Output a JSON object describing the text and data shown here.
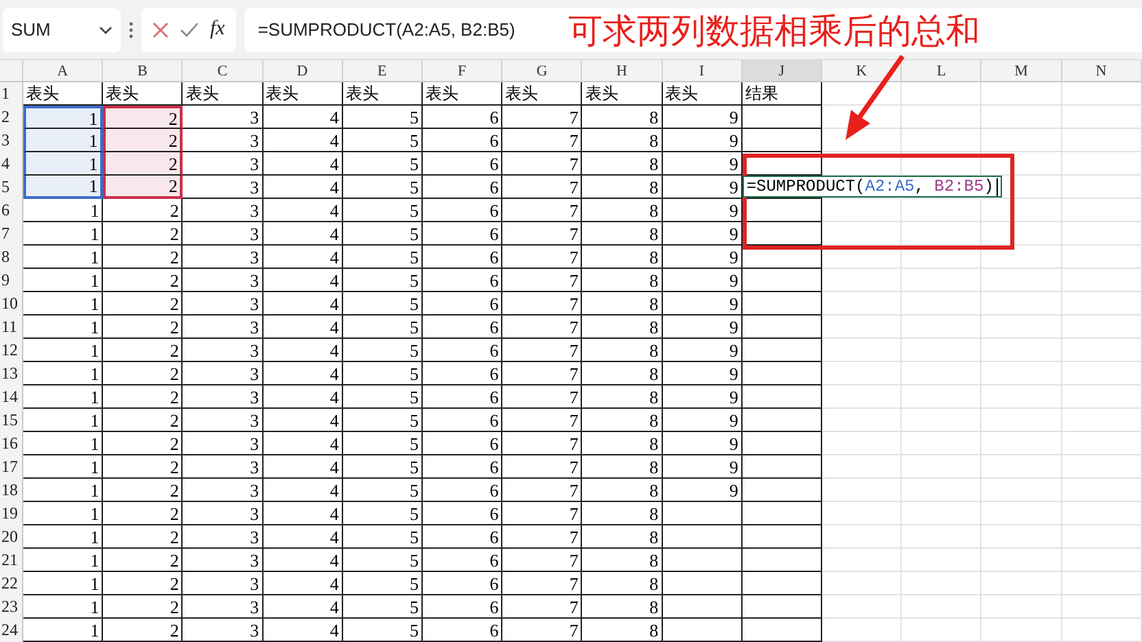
{
  "formula_bar": {
    "name_box": "SUM",
    "fx_label": "fx",
    "formula": "=SUMPRODUCT(A2:A5, B2:B5)"
  },
  "annotation": {
    "text": "可求两列数据相乘后的总和"
  },
  "columns": [
    "A",
    "B",
    "C",
    "D",
    "E",
    "F",
    "G",
    "H",
    "I",
    "J",
    "K",
    "L",
    "M",
    "N"
  ],
  "rows": [
    {
      "header": "1",
      "cells": [
        "表头",
        "表头",
        "表头",
        "表头",
        "表头",
        "表头",
        "表头",
        "表头",
        "表头",
        "结果"
      ]
    },
    {
      "header": "2",
      "cells": [
        "1",
        "2",
        "3",
        "4",
        "5",
        "6",
        "7",
        "8",
        "9"
      ],
      "range_colors": [
        {
          "color": "#3b6fc4"
        },
        {
          "color": "#c8304a"
        }
      ]
    },
    {
      "header": "3",
      "cells": [
        "1",
        "2",
        "3",
        "4",
        "5",
        "6",
        "7",
        "8",
        "9"
      ],
      "range_colors": [
        {
          "color": "#3b6fc4"
        },
        {
          "color": "#c8304a"
        }
      ]
    },
    {
      "header": "4",
      "cells": [
        "1",
        "2",
        "3",
        "4",
        "5",
        "6",
        "7",
        "8",
        "9"
      ],
      "range_colors": [
        {
          "color": "#3b6fc4"
        },
        {
          "color": "#c8304a"
        }
      ]
    },
    {
      "header": "5",
      "cells": [
        "1",
        "2",
        "3",
        "4",
        "5",
        "6",
        "7",
        "8",
        "9"
      ],
      "range_colors": [
        {
          "color": "#3b6fc4"
        },
        {
          "color": "#c8304a"
        }
      ],
      "editing": [
        {
          "text": "=SUMPRODUCT(",
          "color": "#000000"
        },
        {
          "text": "A2:A5",
          "color": "#3b6fc4"
        },
        {
          "text": ", ",
          "color": "#000000"
        },
        {
          "text": "B2:B5",
          "color": "#9a3a8a"
        },
        {
          "text": ")",
          "color": "#000000"
        }
      ]
    },
    {
      "header": "6",
      "cells": [
        "1",
        "2",
        "3",
        "4",
        "5",
        "6",
        "7",
        "8",
        "9"
      ]
    },
    {
      "header": "7",
      "cells": [
        "1",
        "2",
        "3",
        "4",
        "5",
        "6",
        "7",
        "8",
        "9"
      ]
    },
    {
      "header": "8",
      "cells": [
        "1",
        "2",
        "3",
        "4",
        "5",
        "6",
        "7",
        "8",
        "9"
      ]
    },
    {
      "header": "9",
      "cells": [
        "1",
        "2",
        "3",
        "4",
        "5",
        "6",
        "7",
        "8",
        "9"
      ]
    },
    {
      "header": "10",
      "cells": [
        "1",
        "2",
        "3",
        "4",
        "5",
        "6",
        "7",
        "8",
        "9"
      ]
    },
    {
      "header": "11",
      "cells": [
        "1",
        "2",
        "3",
        "4",
        "5",
        "6",
        "7",
        "8",
        "9"
      ]
    },
    {
      "header": "12",
      "cells": [
        "1",
        "2",
        "3",
        "4",
        "5",
        "6",
        "7",
        "8",
        "9"
      ]
    },
    {
      "header": "13",
      "cells": [
        "1",
        "2",
        "3",
        "4",
        "5",
        "6",
        "7",
        "8",
        "9"
      ]
    },
    {
      "header": "14",
      "cells": [
        "1",
        "2",
        "3",
        "4",
        "5",
        "6",
        "7",
        "8",
        "9"
      ]
    },
    {
      "header": "15",
      "cells": [
        "1",
        "2",
        "3",
        "4",
        "5",
        "6",
        "7",
        "8",
        "9"
      ]
    },
    {
      "header": "16",
      "cells": [
        "1",
        "2",
        "3",
        "4",
        "5",
        "6",
        "7",
        "8",
        "9"
      ]
    },
    {
      "header": "17",
      "cells": [
        "1",
        "2",
        "3",
        "4",
        "5",
        "6",
        "7",
        "8",
        "9"
      ]
    },
    {
      "header": "18",
      "cells": [
        "1",
        "2",
        "3",
        "4",
        "5",
        "6",
        "7",
        "8",
        "9"
      ]
    },
    {
      "header": "19",
      "cells": [
        "1",
        "2",
        "3",
        "4",
        "5",
        "6",
        "7",
        "8"
      ]
    },
    {
      "header": "20",
      "cells": [
        "1",
        "2",
        "3",
        "4",
        "5",
        "6",
        "7",
        "8"
      ]
    },
    {
      "header": "21",
      "cells": [
        "1",
        "2",
        "3",
        "4",
        "5",
        "6",
        "7",
        "8"
      ]
    },
    {
      "header": "22",
      "cells": [
        "1",
        "2",
        "3",
        "4",
        "5",
        "6",
        "7",
        "8"
      ]
    },
    {
      "header": "23",
      "cells": [
        "1",
        "2",
        "3",
        "4",
        "5",
        "6",
        "7",
        "8"
      ]
    },
    {
      "header": "24",
      "cells": [
        "1",
        "2",
        "3",
        "4",
        "5",
        "6",
        "7",
        "8"
      ]
    }
  ]
}
